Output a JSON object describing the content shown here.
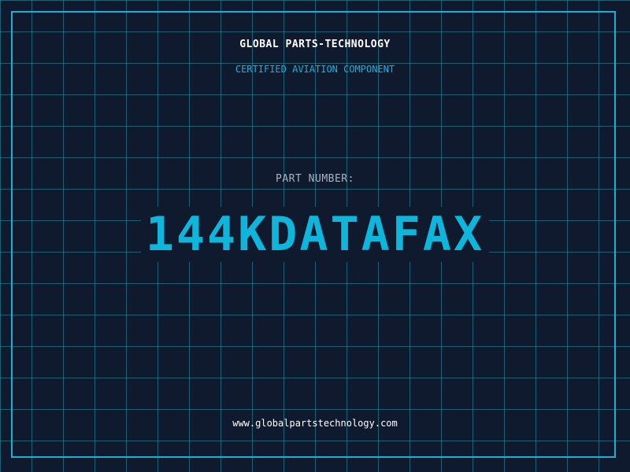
{
  "header": {
    "company": "GLOBAL PARTS-TECHNOLOGY",
    "subtitle": "CERTIFIED AVIATION COMPONENT"
  },
  "part": {
    "label": "PART NUMBER:",
    "number": "144KDATAFAX"
  },
  "footer": {
    "website": "www.globalpartstechnology.com"
  },
  "colors": {
    "background": "#101a2e",
    "grid": "#2896aa",
    "accent": "#1ab0d6",
    "part_number": "#0fb6dc",
    "label": "#a8b3c4"
  }
}
